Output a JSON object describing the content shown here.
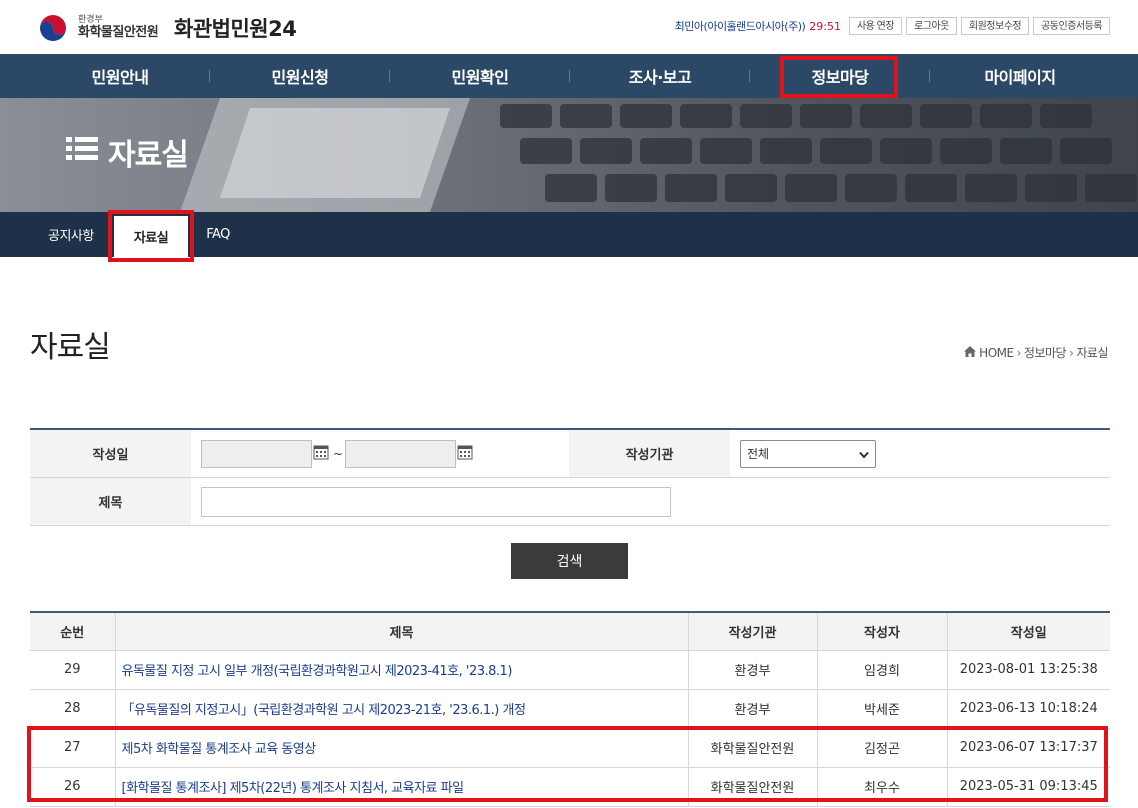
{
  "header": {
    "logo_small": "환경부",
    "logo_org": "화학물질안전원",
    "site_title": "화관법민원24",
    "user_name": "최민아(아이홀랜드아시아(주))",
    "session_time": "29:51",
    "util_buttons": [
      "사용 연장",
      "로그아웃",
      "회원정보수정",
      "공동인증서등록"
    ]
  },
  "gnb": {
    "items": [
      "민원안내",
      "민원신청",
      "민원확인",
      "조사·보고",
      "정보마당",
      "마이페이지"
    ]
  },
  "hero": {
    "title": "자료실"
  },
  "subnav": {
    "items": [
      "공지사항",
      "자료실",
      "FAQ"
    ]
  },
  "page": {
    "title": "자료실",
    "breadcrumb": [
      "HOME",
      "정보마당",
      "자료실"
    ]
  },
  "search": {
    "date_label": "작성일",
    "date_from": "",
    "date_to": "",
    "tilde": "~",
    "org_label": "작성기관",
    "org_selected": "전체",
    "title_label": "제목",
    "title_value": "",
    "button_label": "검색"
  },
  "table": {
    "headers": [
      "순번",
      "제목",
      "작성기관",
      "작성자",
      "작성일"
    ],
    "rows": [
      {
        "no": "29",
        "title": "유독물질 지정 고시 일부 개정(국립환경과학원고시 제2023-41호, '23.8.1)",
        "org": "환경부",
        "writer": "임경희",
        "date": "2023-08-01 13:25:38"
      },
      {
        "no": "28",
        "title": "「유독물질의 지정고시」(국립환경과학원 고시 제2023-21호, '23.6.1.) 개정",
        "org": "환경부",
        "writer": "박세준",
        "date": "2023-06-13 10:18:24"
      },
      {
        "no": "27",
        "title": "제5차 화학물질 통계조사 교육 동영상",
        "org": "화학물질안전원",
        "writer": "김정곤",
        "date": "2023-06-07 13:17:37"
      },
      {
        "no": "26",
        "title": "[화학물질 통계조사] 제5차(22년) 통계조사 지침서, 교육자료 파일",
        "org": "화학물질안전원",
        "writer": "최우수",
        "date": "2023-05-31 09:13:45"
      }
    ]
  },
  "colors": {
    "gnb_bg": "#2b4866",
    "subnav_bg": "#1f3148",
    "highlight": "#e0131c",
    "link": "#1b3d8f",
    "time": "#c8102e"
  }
}
